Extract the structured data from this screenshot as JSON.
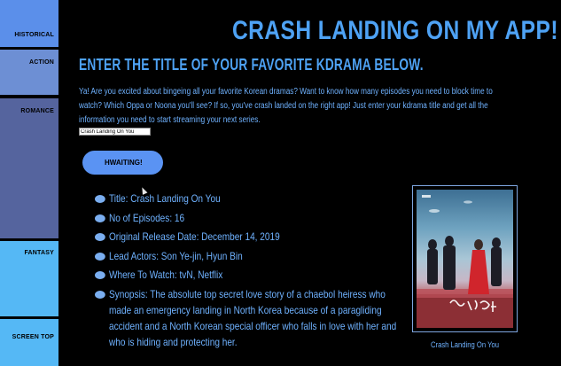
{
  "nav": {
    "items": [
      {
        "label": "HISTORICAL"
      },
      {
        "label": "ACTION"
      },
      {
        "label": "ROMANCE"
      },
      {
        "label": "FANTASY"
      },
      {
        "label": "SCREEN TOP"
      }
    ]
  },
  "header": {
    "title": "CRASH LANDING ON MY APP!",
    "subtitle": "ENTER THE TITLE OF YOUR FAVORITE KDRAMA BELOW."
  },
  "intro": {
    "text": "Ya! Are you excited about bingeing all your favorite Korean dramas? Want to know how many episodes you need to block time to watch? Which Oppa or Noona you'll see? If so, you've crash landed on the right app! Just enter your kdrama title and get all the information you need to start streaming your next series."
  },
  "search": {
    "value": "Crash Landing On You",
    "button_label": "HWAITING!"
  },
  "details": {
    "title": "Title: Crash Landing On You",
    "episodes": "No of Episodes: 16",
    "release": "Original Release Date: December 14, 2019",
    "actors": "Lead Actors: Son Ye-jin, Hyun Bin",
    "watch": "Where To Watch: tvN, Netflix",
    "synopsis": "Synopsis: The absolute top secret love story of a chaebol heiress who made an emergency landing in North Korea because of a paragliding accident and a North Korean special officer who falls in love with her and who is hiding and protecting her."
  },
  "poster": {
    "caption": "Crash Landing On You"
  },
  "colors": {
    "accent": "#4ea2f4",
    "text": "#6fb2ff",
    "nav_historical": "#5b8fea",
    "nav_action": "#6d8fd4",
    "nav_romance": "#5a6aa6",
    "nav_fantasy": "#55b8f5",
    "nav_screen_top": "#55b8f5",
    "button": "#5a93f3",
    "background": "#000000"
  }
}
